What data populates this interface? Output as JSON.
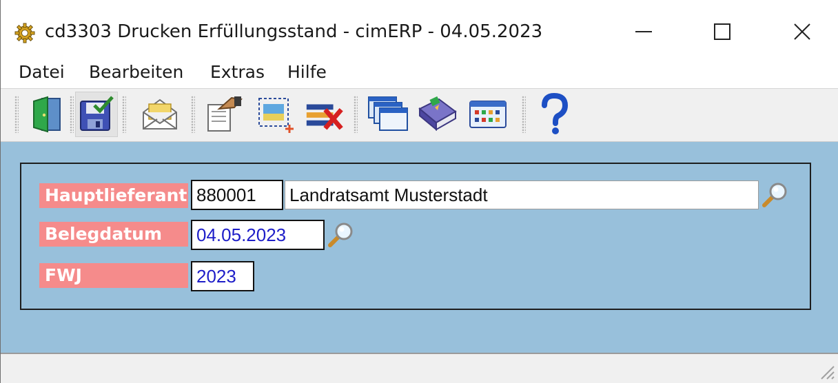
{
  "window": {
    "title": "cd3303 Drucken Erfüllungsstand - cimERP - 04.05.2023",
    "icon": "gear-icon",
    "controls": [
      "minimize-icon",
      "maximize-icon",
      "close-icon"
    ]
  },
  "menubar": {
    "items": [
      {
        "label": "Datei"
      },
      {
        "label": "Bearbeiten"
      },
      {
        "label": "Extras"
      },
      {
        "label": "Hilfe"
      }
    ]
  },
  "toolbar": {
    "buttons": [
      {
        "icon": "exit-door-icon"
      },
      {
        "icon": "save-disk-check-icon",
        "pressed": true
      },
      {
        "icon": "mail-envelope-icon"
      },
      {
        "icon": "edit-note-icon"
      },
      {
        "icon": "select-new-icon"
      },
      {
        "icon": "delete-list-icon"
      },
      {
        "icon": "windows-icon"
      },
      {
        "icon": "book-icon"
      },
      {
        "icon": "columns-grid-icon"
      },
      {
        "icon": "help-question-icon"
      }
    ]
  },
  "form": {
    "hauptlieferant": {
      "label": "Hauptlieferant",
      "value": "880001",
      "name": "Landratsamt Musterstadt"
    },
    "belegdatum": {
      "label": "Belegdatum",
      "value": "04.05.2023"
    },
    "fwj": {
      "label": "FWJ",
      "value": "2023"
    }
  },
  "colors": {
    "label_bg": "#f58b8b",
    "content_bg": "#98c0db",
    "value_blue": "#1d1dc8"
  }
}
